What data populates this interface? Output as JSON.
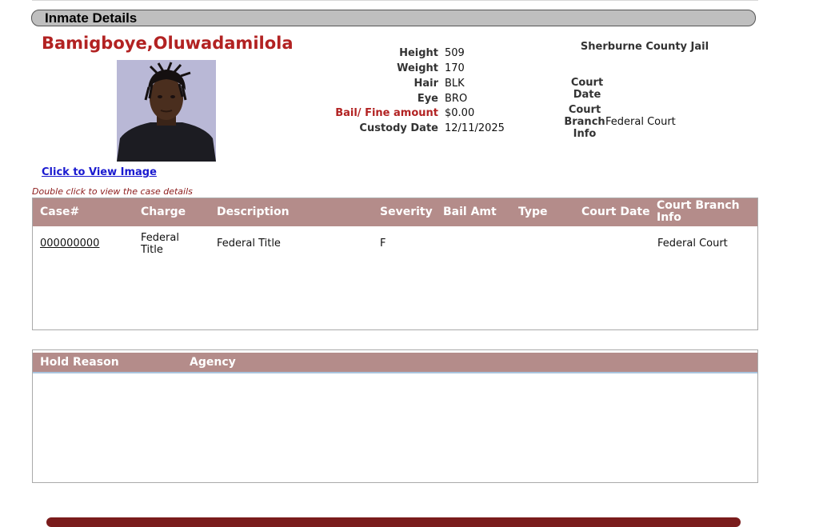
{
  "header": {
    "title": "Inmate Details"
  },
  "inmate": {
    "name": "Bamigboye,Oluwadamilola",
    "view_image_link": "Click to View Image",
    "details": [
      {
        "label": "Height",
        "value": "509"
      },
      {
        "label": "Weight",
        "value": "170"
      },
      {
        "label": "Hair",
        "value": "BLK"
      },
      {
        "label": "Eye",
        "value": "BRO"
      },
      {
        "label": "Bail/ Fine amount",
        "value": "$0.00"
      },
      {
        "label": "Custody Date",
        "value": "12/11/2025"
      }
    ],
    "facility": "Sherburne County Jail",
    "court_date_label": "Court Date",
    "court_branch_label": "Court Branch Info",
    "court_branch_value": "Federal Court"
  },
  "cases": {
    "hint": "Double click to view the case details",
    "columns": [
      "Case#",
      "Charge",
      "Description",
      "Severity",
      "Bail Amt",
      "Type",
      "Court Date",
      "Court Branch Info"
    ],
    "rows": [
      {
        "case_no": "000000000",
        "charge": "Federal Title",
        "description": "Federal Title",
        "severity": "F",
        "bail_amt": "",
        "type": "",
        "court_date": "",
        "court_branch": "Federal Court"
      }
    ]
  },
  "holds": {
    "columns": [
      "Hold Reason",
      "Agency"
    ]
  },
  "colors": {
    "accent_red": "#b22222",
    "table_header": "#b48c8a",
    "link_blue": "#1a1ad0"
  }
}
